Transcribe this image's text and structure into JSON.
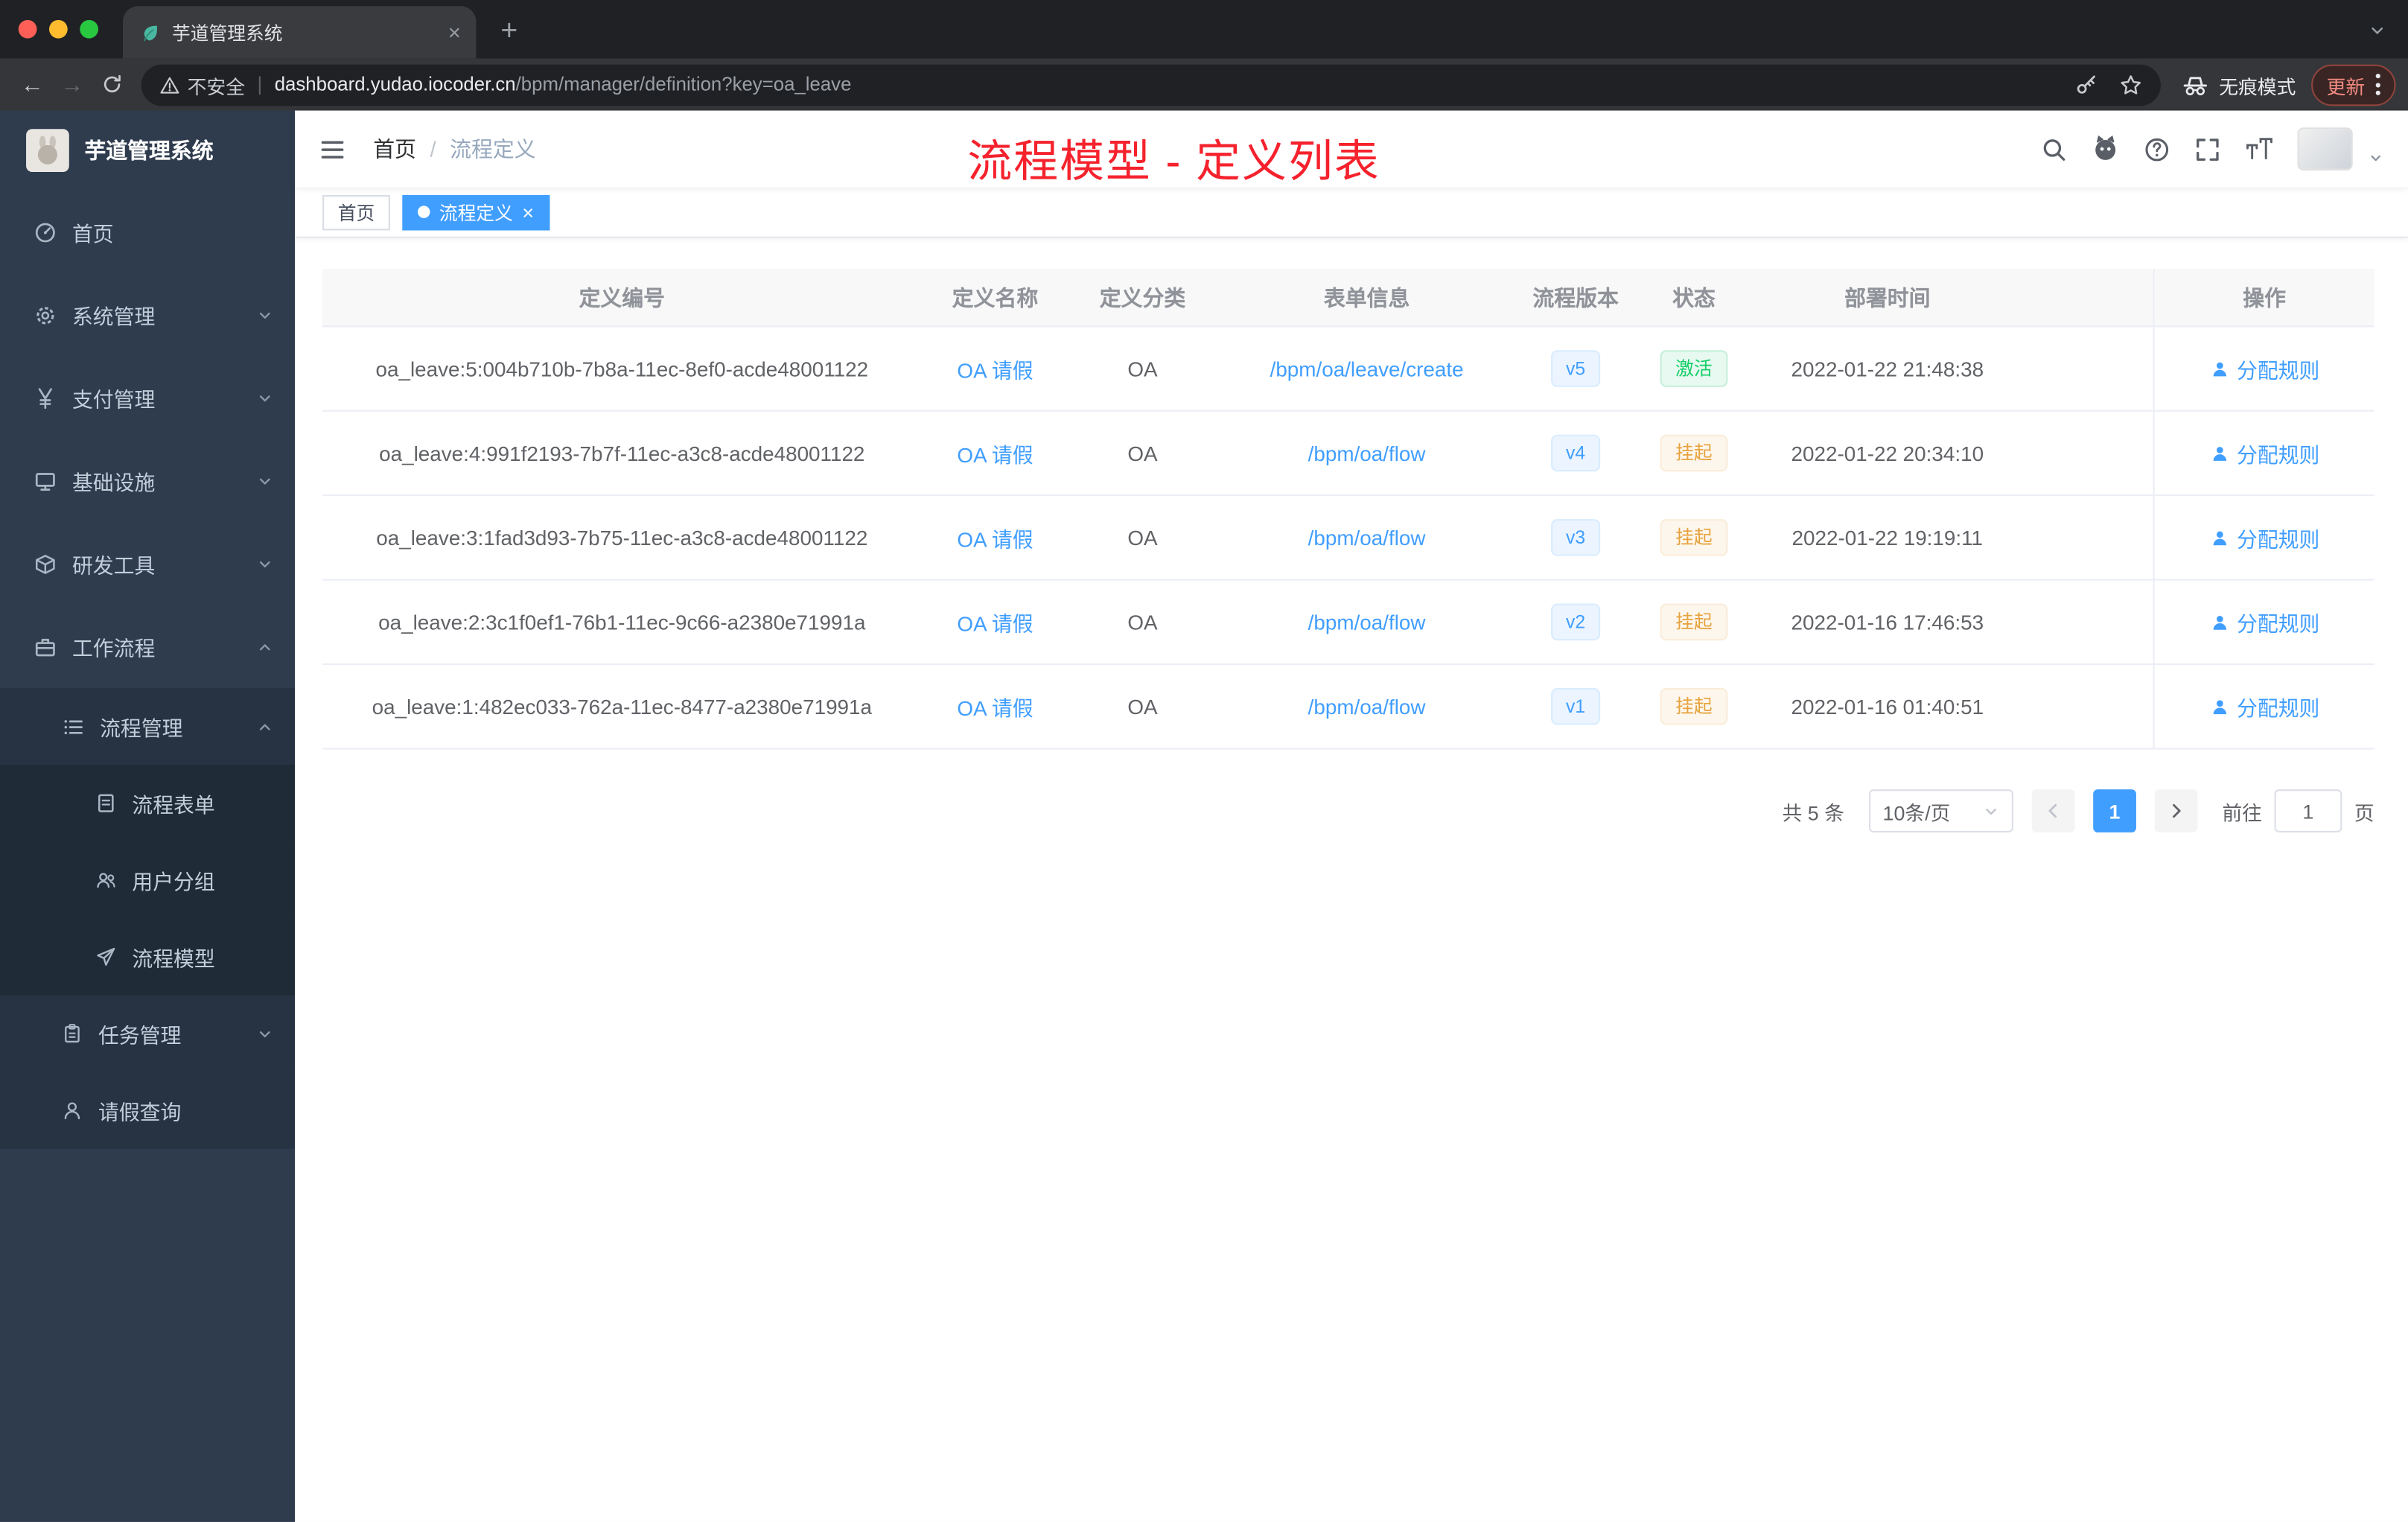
{
  "colors": {
    "accent": "#409eff",
    "annotation_red": "#f5222d",
    "success_green": "#13ce66",
    "warning_orange": "#e6a23c",
    "sidebar_bg": "#2f3c4e",
    "chrome_dark": "#202124"
  },
  "browser": {
    "tab_title": "芋道管理系统",
    "security_label": "不安全",
    "url_sep": "|",
    "url_host": "dashboard.yudao.iocoder.cn",
    "url_path": "/bpm/manager/definition?key=oa_leave",
    "incognito_label": "无痕模式",
    "update_label": "更新"
  },
  "sidebar": {
    "logo_title": "芋道管理系统",
    "items": [
      {
        "label": "首页"
      },
      {
        "label": "系统管理"
      },
      {
        "label": "支付管理"
      },
      {
        "label": "基础设施"
      },
      {
        "label": "研发工具"
      },
      {
        "label": "工作流程"
      },
      {
        "label": "流程管理"
      },
      {
        "label": "流程表单"
      },
      {
        "label": "用户分组"
      },
      {
        "label": "流程模型"
      },
      {
        "label": "任务管理"
      },
      {
        "label": "请假查询"
      }
    ]
  },
  "header": {
    "breadcrumb_home": "首页",
    "breadcrumb_sep": "/",
    "breadcrumb_current": "流程定义",
    "annotation": "流程模型 - 定义列表"
  },
  "tags": [
    {
      "label": "首页"
    },
    {
      "label": "流程定义"
    }
  ],
  "table": {
    "columns": [
      "定义编号",
      "定义名称",
      "定义分类",
      "表单信息",
      "流程版本",
      "状态",
      "部署时间",
      "操作"
    ],
    "rows": [
      {
        "id": "oa_leave:5:004b710b-7b8a-11ec-8ef0-acde48001122",
        "name": "OA 请假",
        "category": "OA",
        "form": "/bpm/oa/leave/create",
        "version": "v5",
        "status": "激活",
        "deploy_time": "2022-01-22 21:48:38",
        "action": "分配规则"
      },
      {
        "id": "oa_leave:4:991f2193-7b7f-11ec-a3c8-acde48001122",
        "name": "OA 请假",
        "category": "OA",
        "form": "/bpm/oa/flow",
        "version": "v4",
        "status": "挂起",
        "deploy_time": "2022-01-22 20:34:10",
        "action": "分配规则"
      },
      {
        "id": "oa_leave:3:1fad3d93-7b75-11ec-a3c8-acde48001122",
        "name": "OA 请假",
        "category": "OA",
        "form": "/bpm/oa/flow",
        "version": "v3",
        "status": "挂起",
        "deploy_time": "2022-01-22 19:19:11",
        "action": "分配规则"
      },
      {
        "id": "oa_leave:2:3c1f0ef1-76b1-11ec-9c66-a2380e71991a",
        "name": "OA 请假",
        "category": "OA",
        "form": "/bpm/oa/flow",
        "version": "v2",
        "status": "挂起",
        "deploy_time": "2022-01-16 17:46:53",
        "action": "分配规则"
      },
      {
        "id": "oa_leave:1:482ec033-762a-11ec-8477-a2380e71991a",
        "name": "OA 请假",
        "category": "OA",
        "form": "/bpm/oa/flow",
        "version": "v1",
        "status": "挂起",
        "deploy_time": "2022-01-16 01:40:51",
        "action": "分配规则"
      }
    ]
  },
  "pagination": {
    "total": "共 5 条",
    "page_size": "10条/页",
    "current_page": "1",
    "goto_label": "前往",
    "goto_value": "1",
    "page_label": "页"
  }
}
